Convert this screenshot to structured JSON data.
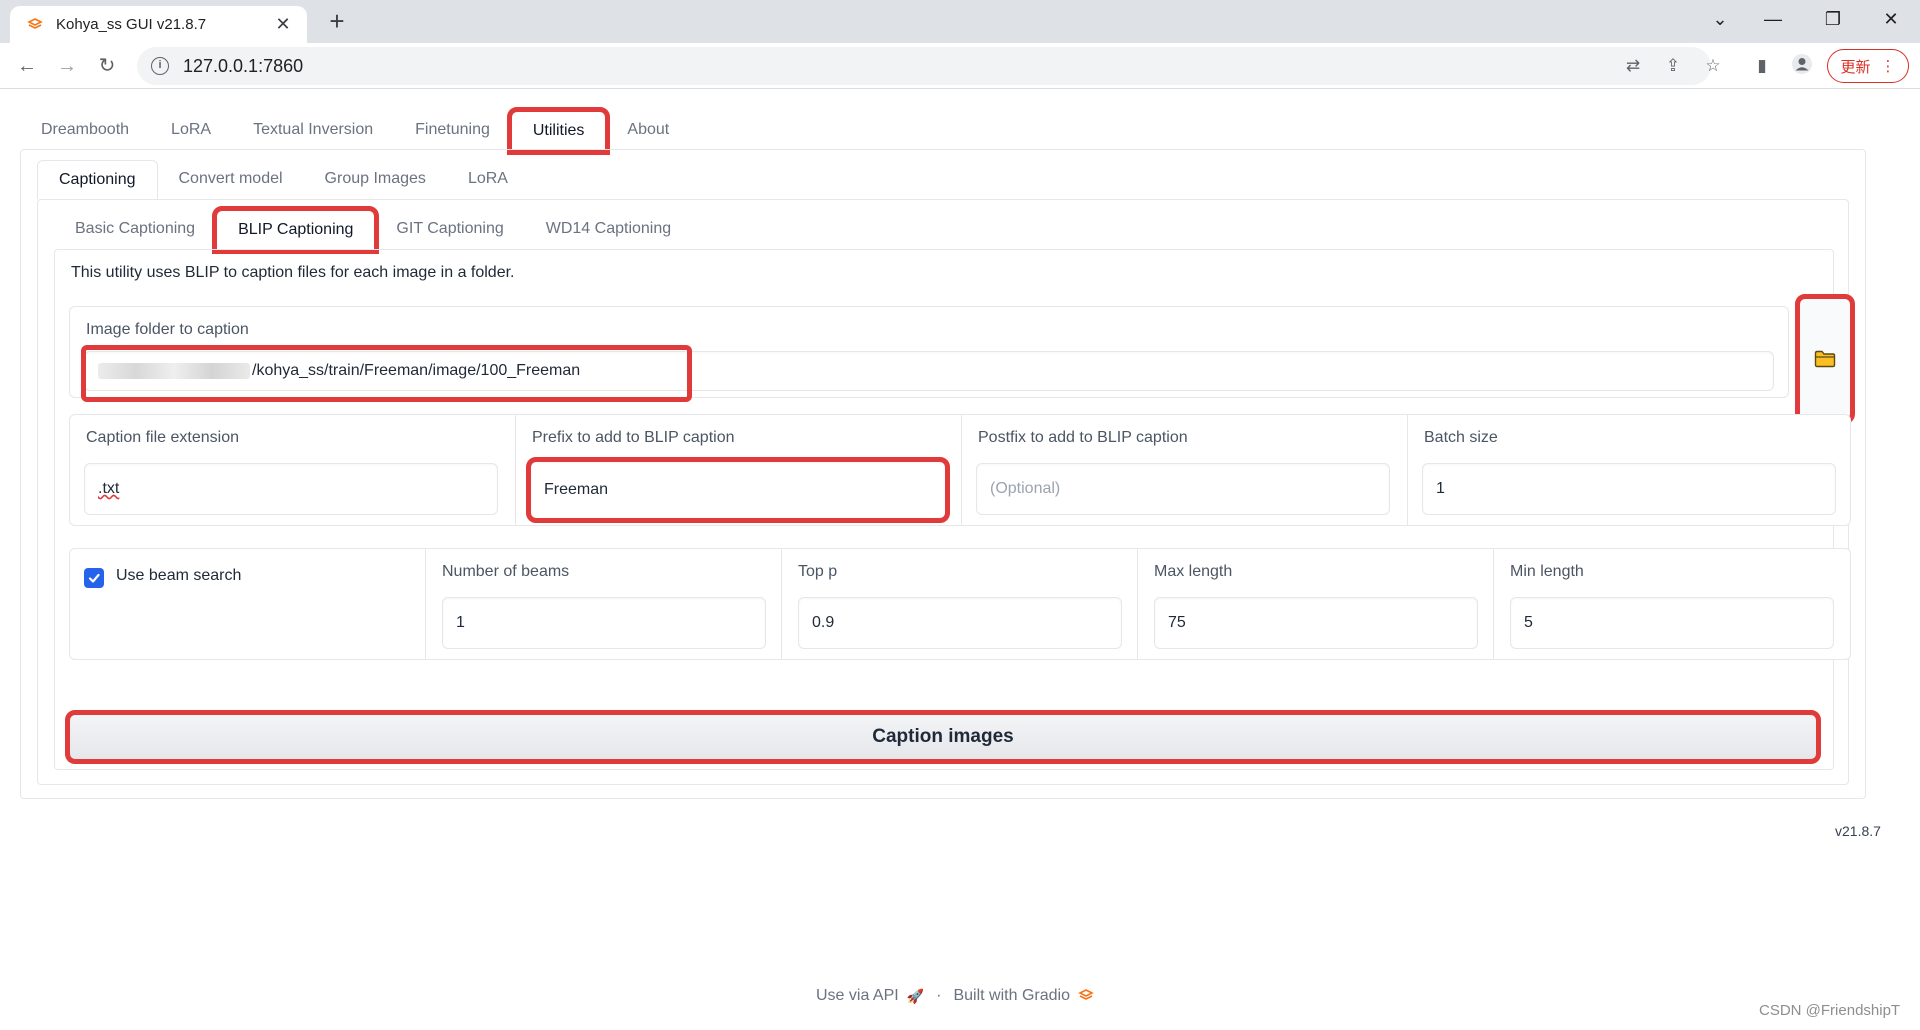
{
  "browser": {
    "tab_title": "Kohya_ss GUI v21.8.7",
    "url": "127.0.0.1:7860",
    "update_label": "更新"
  },
  "main_tabs": [
    {
      "label": "Dreambooth"
    },
    {
      "label": "LoRA"
    },
    {
      "label": "Textual Inversion"
    },
    {
      "label": "Finetuning"
    },
    {
      "label": "Utilities"
    },
    {
      "label": "About"
    }
  ],
  "utility_tabs": [
    {
      "label": "Captioning"
    },
    {
      "label": "Convert model"
    },
    {
      "label": "Group Images"
    },
    {
      "label": "LoRA"
    }
  ],
  "caption_tabs": [
    {
      "label": "Basic Captioning"
    },
    {
      "label": "BLIP Captioning"
    },
    {
      "label": "GIT Captioning"
    },
    {
      "label": "WD14 Captioning"
    }
  ],
  "blip": {
    "description": "This utility uses BLIP to caption files for each image in a folder.",
    "folder_label": "Image folder to caption",
    "folder_value": "/kohya_ss/train/Freeman/image/100_Freeman",
    "ext_label": "Caption file extension",
    "ext_value": ".txt",
    "prefix_label": "Prefix to add to BLIP caption",
    "prefix_value": "Freeman",
    "postfix_label": "Postfix to add to BLIP caption",
    "postfix_placeholder": "(Optional)",
    "batch_label": "Batch size",
    "batch_value": "1",
    "beam_label": "Use beam search",
    "beams_label": "Number of beams",
    "beams_value": "1",
    "topp_label": "Top p",
    "topp_value": "0.9",
    "maxlen_label": "Max length",
    "maxlen_value": "75",
    "minlen_label": "Min length",
    "minlen_value": "5",
    "button_label": "Caption images"
  },
  "version": "v21.8.7",
  "footer": {
    "api": "Use via API",
    "dot": "·",
    "built": "Built with Gradio"
  },
  "watermark": "CSDN @FriendshipT",
  "colors": {
    "highlight": "#e03a3a",
    "checkbox": "#2563eb",
    "gradio_orange": "#f97316"
  }
}
